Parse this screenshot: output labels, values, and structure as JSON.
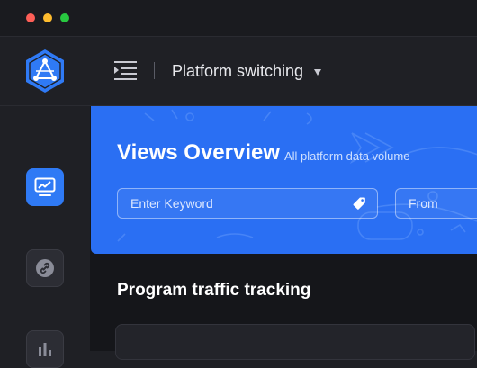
{
  "window": {
    "controls": [
      "close",
      "minimize",
      "maximize"
    ]
  },
  "header": {
    "logo_icon": "hexagon-network-logo-icon",
    "menu_icon": "menu-indent-icon",
    "platform_switch_label": "Platform switching",
    "caret_icon": "caret-down-icon"
  },
  "sidebar": {
    "items": [
      {
        "icon": "trend-monitor-icon",
        "active": true
      },
      {
        "icon": "link-icon",
        "active": false
      },
      {
        "icon": "bar-chart-icon",
        "active": false
      }
    ]
  },
  "banner": {
    "title": "Views Overview",
    "subtitle": "All platform data volume",
    "keyword_placeholder": "Enter Keyword",
    "keyword_value": "",
    "tag_icon": "tag-icon",
    "from_label": "From"
  },
  "section": {
    "title": "Program traffic tracking"
  },
  "colors": {
    "accent": "#2f7af5",
    "banner": "#2a6ff3",
    "background": "#15161a",
    "panel": "#1f2025",
    "mac_red": "#fe5f57",
    "mac_yellow": "#febc2e",
    "mac_green": "#28c840"
  }
}
